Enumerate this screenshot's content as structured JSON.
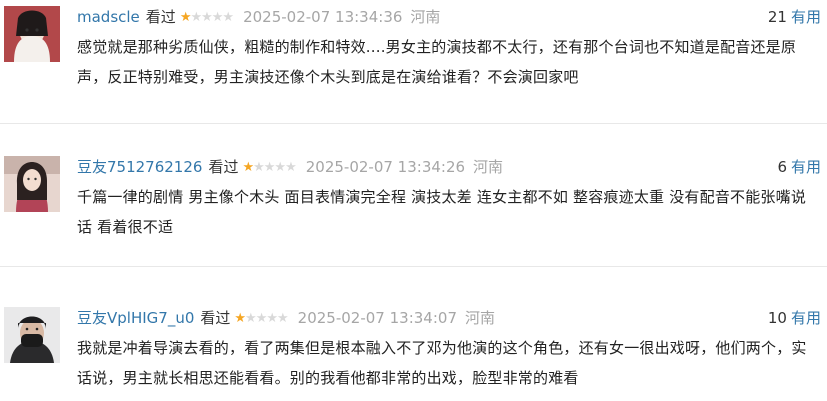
{
  "reviews": [
    {
      "username": "madscle",
      "action": "看过",
      "rating": 1,
      "timestamp": "2025-02-07 13:34:36",
      "location": "河南",
      "useful_count": "21",
      "useful_label": "有用",
      "text": "感觉就是那种劣质仙侠，粗糙的制作和特效....男女主的演技都不太行，还有那个台词也不知道是配音还是原声，反正特别难受，男主演技还像个木头到底是在演给谁看？不会演回家吧"
    },
    {
      "username": "豆友7512762126",
      "action": "看过",
      "rating": 1,
      "timestamp": "2025-02-07 13:34:26",
      "location": "河南",
      "useful_count": "6",
      "useful_label": "有用",
      "text": "千篇一律的剧情 男主像个木头 面目表情演完全程 演技太差 连女主都不如 整容痕迹太重 没有配音不能张嘴说话 看着很不适"
    },
    {
      "username": "豆友VplHIG7_u0",
      "action": "看过",
      "rating": 1,
      "timestamp": "2025-02-07 13:34:07",
      "location": "河南",
      "useful_count": "10",
      "useful_label": "有用",
      "text": "我就是冲着导演去看的，看了两集但是根本融入不了邓为他演的这个角色，还有女一很出戏呀，他们两个，实话说，男主就长相思还能看看。别的我看他都非常的出戏，脸型非常的难看"
    }
  ],
  "colors": {
    "link": "#3377aa",
    "star_on": "#f5a623",
    "star_off": "#d9d9d9",
    "muted": "#a6a6a6"
  }
}
